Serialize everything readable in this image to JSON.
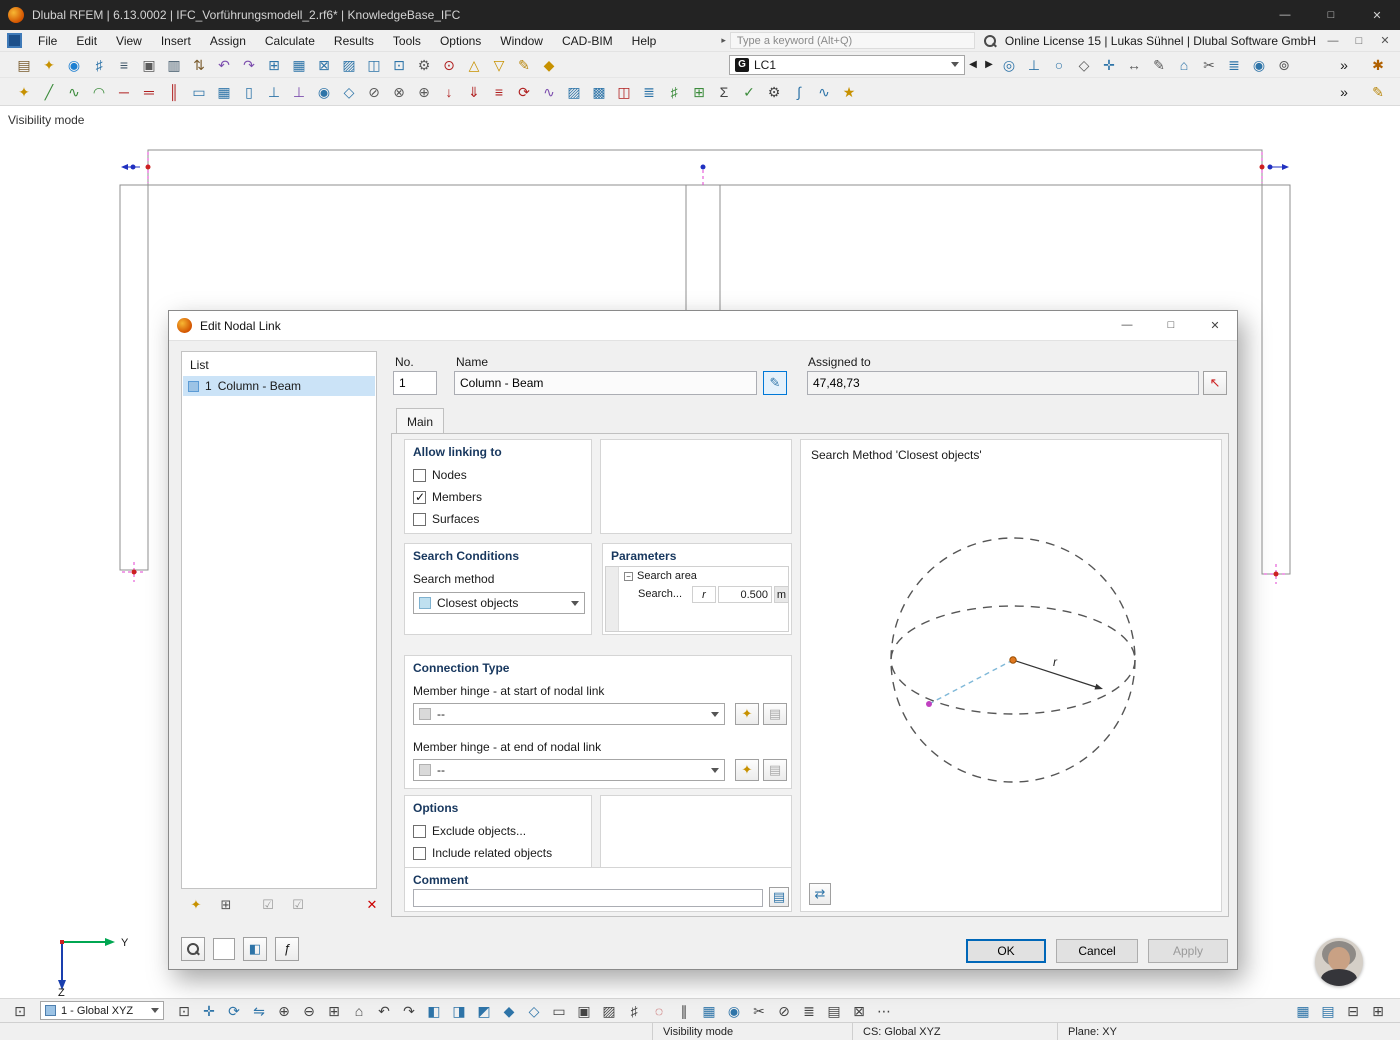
{
  "titlebar": {
    "title": "Dlubal RFEM | 6.13.0002 | IFC_Vorführungsmodell_2.rf6* | KnowledgeBase_IFC"
  },
  "menubar": {
    "items": [
      {
        "name": "menu-file",
        "label": "File"
      },
      {
        "name": "menu-edit",
        "label": "Edit"
      },
      {
        "name": "menu-view",
        "label": "View"
      },
      {
        "name": "menu-insert",
        "label": "Insert"
      },
      {
        "name": "menu-assign",
        "label": "Assign"
      },
      {
        "name": "menu-calculate",
        "label": "Calculate"
      },
      {
        "name": "menu-results",
        "label": "Results"
      },
      {
        "name": "menu-tools",
        "label": "Tools"
      },
      {
        "name": "menu-options",
        "label": "Options"
      },
      {
        "name": "menu-window",
        "label": "Window"
      },
      {
        "name": "menu-cad-bim",
        "label": "CAD-BIM"
      },
      {
        "name": "menu-help",
        "label": "Help"
      }
    ],
    "search_placeholder": "Type a keyword (Alt+Q)",
    "license": "Online License 15 | Lukas Sühnel | Dlubal Software GmbH"
  },
  "toolbars": {
    "load_case": {
      "badge": "G",
      "value": "LC1"
    },
    "row1a": [
      {
        "name": "paste-icon",
        "glyph": "▤",
        "color": "#7a5c2e"
      },
      {
        "name": "new-model-icon",
        "glyph": "✦",
        "color": "#c79100"
      },
      {
        "name": "dlubal-online-icon",
        "glyph": "◉",
        "color": "#1d7fd1"
      },
      {
        "name": "navigator-icon",
        "glyph": "♯",
        "color": "#2e74a8"
      },
      {
        "name": "print-icon",
        "glyph": "≡",
        "color": "#3f5668"
      },
      {
        "name": "save-icon",
        "glyph": "▣",
        "color": "#5a5a5a"
      },
      {
        "name": "printout-report-icon",
        "glyph": "▥",
        "color": "#3f5668"
      },
      {
        "name": "export-icon",
        "glyph": "⇅",
        "color": "#7a5c2e"
      },
      {
        "name": "undo-icon",
        "glyph": "↶",
        "color": "#7d4fae"
      },
      {
        "name": "redo-icon",
        "glyph": "↷",
        "color": "#7d4fae"
      },
      {
        "name": "table-view-icon",
        "glyph": "⊞",
        "color": "#2e74a8"
      },
      {
        "name": "grid-view-icon",
        "glyph": "▦",
        "color": "#2e74a8"
      },
      {
        "name": "section-view-icon",
        "glyph": "⊠",
        "color": "#2e74a8"
      },
      {
        "name": "render-view-icon",
        "glyph": "▨",
        "color": "#2e74a8"
      },
      {
        "name": "display-properties-icon",
        "glyph": "◫",
        "color": "#2e74a8"
      },
      {
        "name": "work-plane-icon",
        "glyph": "⊡",
        "color": "#2e74a8"
      },
      {
        "name": "settings-icon",
        "glyph": "⚙",
        "color": "#5a5a5a"
      },
      {
        "name": "snap-target-icon",
        "glyph": "⊙",
        "color": "#b02020"
      },
      {
        "name": "new-load-icon",
        "glyph": "△",
        "color": "#c79100"
      },
      {
        "name": "filter-loads-icon",
        "glyph": "▽",
        "color": "#c79100"
      },
      {
        "name": "edit-load-icon",
        "glyph": "✎",
        "color": "#b8860b"
      },
      {
        "name": "load-cases-icon",
        "glyph": "◆",
        "color": "#c79100"
      }
    ],
    "row1b": [
      {
        "name": "nodal-link-icon",
        "glyph": "◎",
        "color": "#2e74a8"
      },
      {
        "name": "support-icon",
        "glyph": "⊥",
        "color": "#2e74a8"
      },
      {
        "name": "hinge-icon",
        "glyph": "○",
        "color": "#2e74a8"
      },
      {
        "name": "release-icon",
        "glyph": "◇",
        "color": "#5a5a5a"
      },
      {
        "name": "guide-object-icon",
        "glyph": "✛",
        "color": "#2e74a8"
      },
      {
        "name": "dimension-icon",
        "glyph": "↔",
        "color": "#5a5a5a"
      },
      {
        "name": "annotation-icon",
        "glyph": "✎",
        "color": "#5a5a5a"
      },
      {
        "name": "zoom-fit-icon",
        "glyph": "⌂",
        "color": "#2e74a8"
      },
      {
        "name": "clip-plane-icon",
        "glyph": "✂",
        "color": "#5a5a5a"
      },
      {
        "name": "layers-icon",
        "glyph": "≣",
        "color": "#2e74a8"
      },
      {
        "name": "visibility-icon",
        "glyph": "◉",
        "color": "#2e74a8"
      },
      {
        "name": "selection-icon",
        "glyph": "⊚",
        "color": "#5a5a5a"
      }
    ],
    "row2": [
      {
        "name": "new-node-icon",
        "glyph": "✦",
        "color": "#c79100"
      },
      {
        "name": "new-line-icon",
        "glyph": "╱",
        "color": "#3c8c3c"
      },
      {
        "name": "new-polyline-icon",
        "glyph": "∿",
        "color": "#3c8c3c"
      },
      {
        "name": "new-arc-icon",
        "glyph": "◠",
        "color": "#3c8c3c"
      },
      {
        "name": "new-member-icon",
        "glyph": "─",
        "color": "#b02020"
      },
      {
        "name": "new-beam-icon",
        "glyph": "═",
        "color": "#b02020"
      },
      {
        "name": "new-rib-icon",
        "glyph": "║",
        "color": "#b02020"
      },
      {
        "name": "new-surface-icon",
        "glyph": "▭",
        "color": "#2e74a8"
      },
      {
        "name": "new-solid-icon",
        "glyph": "▦",
        "color": "#2e74a8"
      },
      {
        "name": "new-opening-icon",
        "glyph": "▯",
        "color": "#2e74a8"
      },
      {
        "name": "nodal-support-icon",
        "glyph": "⊥",
        "color": "#2e74a8"
      },
      {
        "name": "line-support-icon",
        "glyph": "⊥",
        "color": "#7d4fae"
      },
      {
        "name": "member-hinge-icon",
        "glyph": "◉",
        "color": "#2e74a8"
      },
      {
        "name": "eccentricity-icon",
        "glyph": "◇",
        "color": "#2e74a8"
      },
      {
        "name": "divide-icon",
        "glyph": "⊘",
        "color": "#5a5a5a"
      },
      {
        "name": "intersect-icon",
        "glyph": "⊗",
        "color": "#5a5a5a"
      },
      {
        "name": "connect-icon",
        "glyph": "⊕",
        "color": "#5a5a5a"
      },
      {
        "name": "nodal-load-icon",
        "glyph": "↓",
        "color": "#b02020"
      },
      {
        "name": "member-load-icon",
        "glyph": "⇓",
        "color": "#b02020"
      },
      {
        "name": "area-load-icon",
        "glyph": "≡",
        "color": "#b02020"
      },
      {
        "name": "moment-load-icon",
        "glyph": "⟳",
        "color": "#b02020"
      },
      {
        "name": "imperfection-icon",
        "glyph": "∿",
        "color": "#7d4fae"
      },
      {
        "name": "modify-structure-icon",
        "glyph": "▨",
        "color": "#2e74a8"
      },
      {
        "name": "material-icon",
        "glyph": "▩",
        "color": "#2e74a8"
      },
      {
        "name": "cross-section-icon",
        "glyph": "◫",
        "color": "#b02020"
      },
      {
        "name": "thickness-icon",
        "glyph": "≣",
        "color": "#2e74a8"
      },
      {
        "name": "mesh-icon",
        "glyph": "♯",
        "color": "#3c8c3c"
      },
      {
        "name": "mesh-refinement-icon",
        "glyph": "⊞",
        "color": "#3c8c3c"
      },
      {
        "name": "combinations-icon",
        "glyph": "Σ",
        "color": "#444444"
      },
      {
        "name": "check-icon",
        "glyph": "✓",
        "color": "#3c8c3c"
      },
      {
        "name": "calculate-icon",
        "glyph": "⚙",
        "color": "#444444"
      },
      {
        "name": "results-icon",
        "glyph": "∫",
        "color": "#2e74a8"
      },
      {
        "name": "deformation-icon",
        "glyph": "∿",
        "color": "#2e74a8"
      },
      {
        "name": "design-icon",
        "glyph": "★",
        "color": "#c79100"
      }
    ]
  },
  "canvas": {
    "mode_label": "Visibility mode"
  },
  "axes": {
    "y": "Y",
    "z": "Z"
  },
  "dialog": {
    "title": "Edit Nodal Link",
    "list": {
      "label": "List",
      "items": [
        {
          "no": "1",
          "name": "Column - Beam"
        }
      ]
    },
    "fields": {
      "no_label": "No.",
      "no_value": "1",
      "name_label": "Name",
      "name_value": "Column - Beam",
      "assigned_label": "Assigned to",
      "assigned_value": "47,48,73"
    },
    "tab": "Main",
    "allow_linking": {
      "title": "Allow linking to",
      "options": [
        {
          "label": "Nodes",
          "checked": false
        },
        {
          "label": "Members",
          "checked": true
        },
        {
          "label": "Surfaces",
          "checked": false
        }
      ]
    },
    "search_conditions": {
      "title": "Search Conditions",
      "method_label": "Search method",
      "method_value": "Closest objects"
    },
    "parameters": {
      "title": "Parameters",
      "group": "Search area",
      "row": "Search...",
      "symbol": "r",
      "value": "0.500",
      "unit": "m"
    },
    "connection": {
      "title": "Connection Type",
      "start_label": "Member hinge - at start of nodal link",
      "start_value": "--",
      "end_label": "Member hinge - at end of nodal link",
      "end_value": "--"
    },
    "options": {
      "title": "Options",
      "items": [
        {
          "label": "Exclude objects...",
          "checked": false
        },
        {
          "label": "Include related objects",
          "checked": false
        }
      ]
    },
    "comment": {
      "title": "Comment",
      "value": ""
    },
    "preview": {
      "title": "Search Method 'Closest objects'",
      "radius_label": "r"
    },
    "buttons": {
      "ok": "OK",
      "cancel": "Cancel",
      "apply": "Apply"
    }
  },
  "bottombar": {
    "cs_value": "1 - Global XYZ",
    "icons": [
      {
        "name": "select-mode-icon",
        "glyph": "⊡",
        "color": "#444444"
      },
      {
        "name": "move-icon",
        "glyph": "✛",
        "color": "#2e74a8"
      },
      {
        "name": "rotate-icon",
        "glyph": "⟳",
        "color": "#2e74a8"
      },
      {
        "name": "mirror-icon",
        "glyph": "⇋",
        "color": "#2e74a8"
      },
      {
        "name": "zoom-in-icon",
        "glyph": "⊕",
        "color": "#444444"
      },
      {
        "name": "zoom-out-icon",
        "glyph": "⊖",
        "color": "#444444"
      },
      {
        "name": "zoom-window-icon",
        "glyph": "⊞",
        "color": "#444444"
      },
      {
        "name": "zoom-fit-icon",
        "glyph": "⌂",
        "color": "#444444"
      },
      {
        "name": "previous-view-icon",
        "glyph": "↶",
        "color": "#444444"
      },
      {
        "name": "next-view-icon",
        "glyph": "↷",
        "color": "#444444"
      },
      {
        "name": "view-x-icon",
        "glyph": "◧",
        "color": "#2e74a8"
      },
      {
        "name": "view-y-icon",
        "glyph": "◨",
        "color": "#2e74a8"
      },
      {
        "name": "view-z-icon",
        "glyph": "◩",
        "color": "#2e74a8"
      },
      {
        "name": "isometric-view-icon",
        "glyph": "◆",
        "color": "#2e74a8"
      },
      {
        "name": "perspective-view-icon",
        "glyph": "◇",
        "color": "#2e74a8"
      },
      {
        "name": "wireframe-icon",
        "glyph": "▭",
        "color": "#444444"
      },
      {
        "name": "solid-display-icon",
        "glyph": "▣",
        "color": "#444444"
      },
      {
        "name": "shadow-icon",
        "glyph": "▨",
        "color": "#444444"
      },
      {
        "name": "grid-icon",
        "glyph": "♯",
        "color": "#444444"
      },
      {
        "name": "snap-icon",
        "glyph": "◌",
        "color": "#b02020"
      },
      {
        "name": "guidelines-icon",
        "glyph": "∥",
        "color": "#444444"
      },
      {
        "name": "workplane-icon",
        "glyph": "▦",
        "color": "#2e74a8"
      },
      {
        "name": "visibility-mode-icon",
        "glyph": "◉",
        "color": "#2e74a8"
      },
      {
        "name": "clipping-icon",
        "glyph": "✂",
        "color": "#444444"
      },
      {
        "name": "section-plane-icon",
        "glyph": "⊘",
        "color": "#444444"
      },
      {
        "name": "numbering-icon",
        "glyph": "≣",
        "color": "#444444"
      },
      {
        "name": "background-icon",
        "glyph": "▤",
        "color": "#444444"
      },
      {
        "name": "lock-view-icon",
        "glyph": "⊠",
        "color": "#444444"
      },
      {
        "name": "more-tools-icon",
        "glyph": "⋯",
        "color": "#444444"
      }
    ],
    "right_icons": [
      {
        "name": "panel-layout-icon",
        "glyph": "▦",
        "color": "#2e74a8"
      },
      {
        "name": "tables-toggle-icon",
        "glyph": "▤",
        "color": "#2e74a8"
      },
      {
        "name": "split-view-icon",
        "glyph": "⊟",
        "color": "#444444"
      },
      {
        "name": "expand-view-icon",
        "glyph": "⊞",
        "color": "#444444"
      }
    ]
  },
  "statusbar": {
    "mode": "Visibility mode",
    "cs": "CS: Global XYZ",
    "plane": "Plane: XY"
  },
  "icons": {
    "minimize": "—",
    "maximize": "□",
    "close": "✕",
    "pane_min": "—",
    "pane_max": "□",
    "pane_close": "✕",
    "prev": "◀",
    "next": "▶",
    "overflow": "»",
    "bug": "✱",
    "pencil": "✎",
    "list_new": "✦",
    "list_copy": "⊞",
    "list_select": "☑",
    "list_select2": "☑",
    "list_delete": "✕",
    "hinge_new": "✦",
    "hinge_copy": "▤",
    "comment_button": "▤",
    "preview_settings": "⇄",
    "display_settings": "◧",
    "function": "ƒ"
  }
}
